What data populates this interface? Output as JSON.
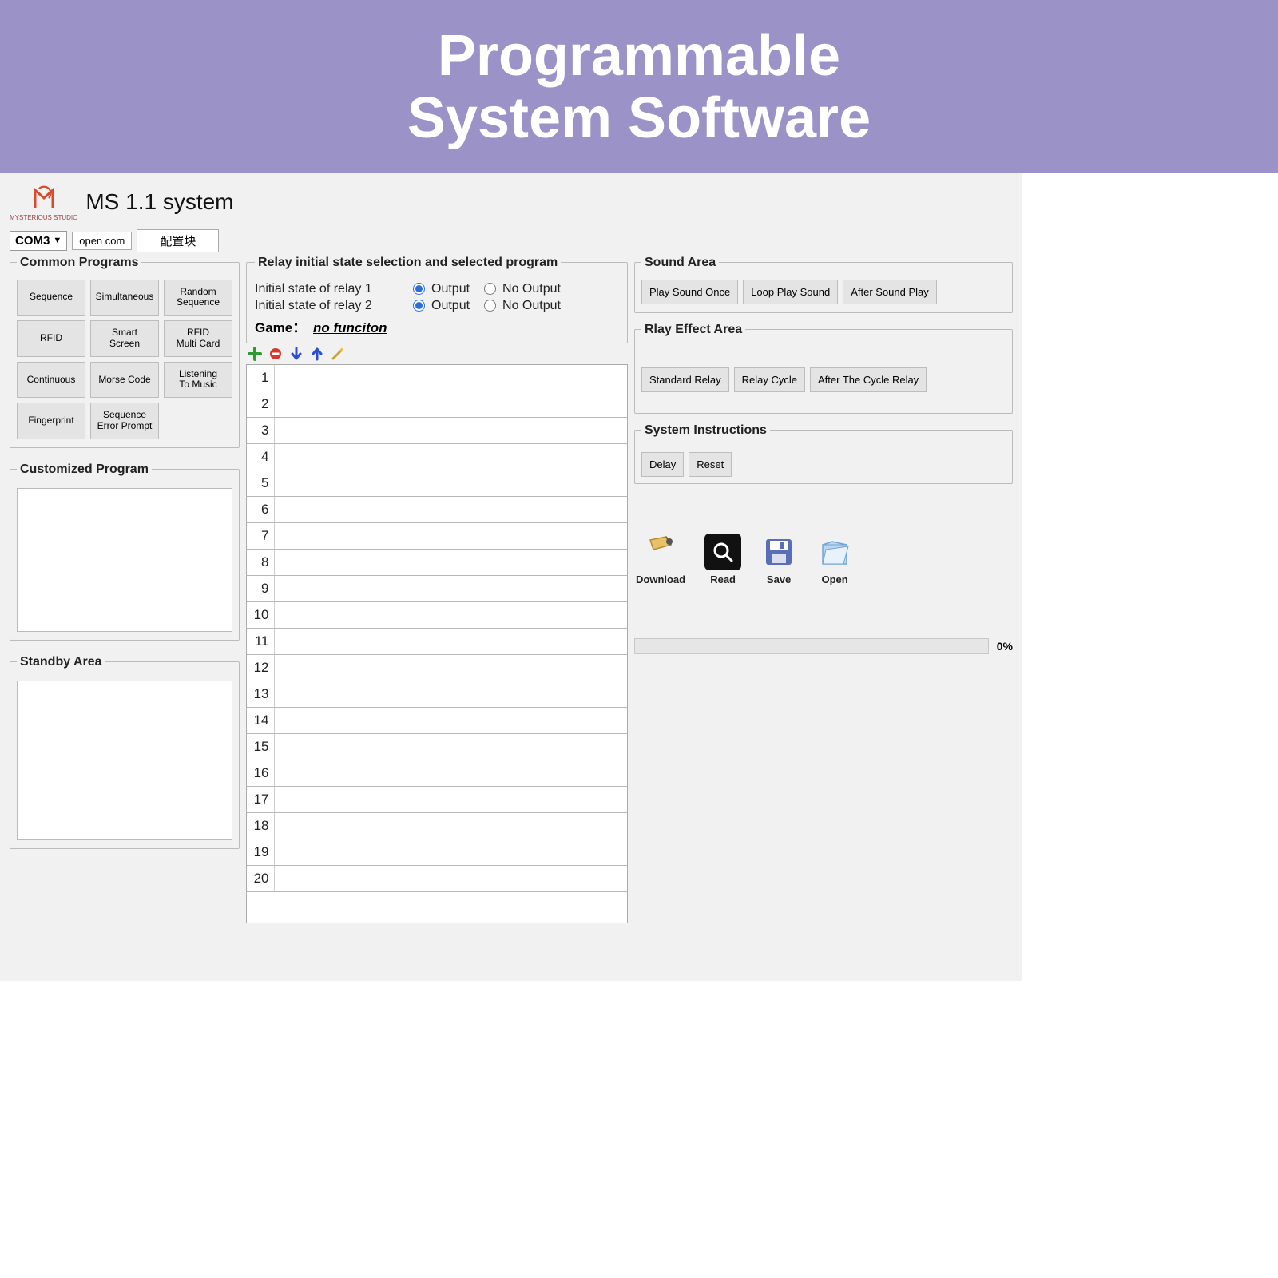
{
  "banner": {
    "line1": "Programmable",
    "line2": "System Software"
  },
  "title": "MS 1.1 system",
  "logo_sub": "MYSTERIOUS STUDIO",
  "com": {
    "selected": "COM3",
    "open_label": "open com",
    "config_label": "配置块"
  },
  "common_programs": {
    "legend": "Common Programs",
    "items": [
      "Sequence",
      "Simultaneous",
      "Random\nSequence",
      "RFID",
      "Smart\nScreen",
      "RFID\nMulti Card",
      "Continuous",
      "Morse Code",
      "Listening\nTo Music",
      "Fingerprint",
      "Sequence\nError Prompt"
    ]
  },
  "customized": {
    "legend": "Customized Program"
  },
  "standby": {
    "legend": "Standby Area"
  },
  "relay": {
    "legend": "Relay initial state selection and selected program",
    "row1_label": "Initial state of relay 1",
    "row2_label": "Initial state of relay 2",
    "opt_output": "Output",
    "opt_no_output": "No Output",
    "relay1": "output",
    "relay2": "output",
    "game_label": "Game：",
    "game_value": "no funciton"
  },
  "grid": {
    "rows": 20
  },
  "sound_area": {
    "legend": "Sound Area",
    "buttons": [
      "Play Sound Once",
      "Loop Play Sound",
      "After Sound Play"
    ]
  },
  "relay_effect": {
    "legend": "Rlay Effect Area",
    "buttons": [
      "Standard Relay",
      "Relay Cycle",
      "After The Cycle Relay"
    ]
  },
  "system_instructions": {
    "legend": "System Instructions",
    "buttons": [
      "Delay",
      "Reset"
    ]
  },
  "file_actions": {
    "download": "Download",
    "read": "Read",
    "save": "Save",
    "open": "Open"
  },
  "progress": {
    "percent": "0%"
  }
}
